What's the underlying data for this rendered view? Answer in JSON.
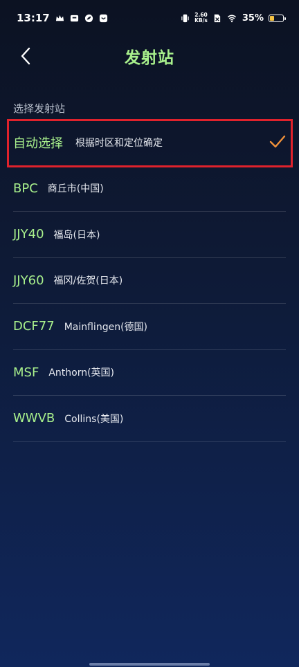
{
  "status_bar": {
    "time": "13:17",
    "speed_value": "2.60",
    "speed_unit": "KB/s",
    "battery_percent": "35%",
    "battery_level": 0.35
  },
  "header": {
    "title": "发射站"
  },
  "section_label": "选择发射站",
  "stations": [
    {
      "code": "自动选择",
      "desc": "根据时区和定位确定",
      "selected": true
    },
    {
      "code": "BPC",
      "desc": "商丘市(中国)",
      "selected": false
    },
    {
      "code": "JJY40",
      "desc": "福岛(日本)",
      "selected": false
    },
    {
      "code": "JJY60",
      "desc": "福冈/佐贺(日本)",
      "selected": false
    },
    {
      "code": "DCF77",
      "desc": "Mainflingen(德国)",
      "selected": false
    },
    {
      "code": "MSF",
      "desc": "Anthorn(英国)",
      "selected": false
    },
    {
      "code": "WWVB",
      "desc": "Collins(美国)",
      "selected": false
    }
  ],
  "colors": {
    "accent_green": "#a8f08c",
    "check_orange": "#f0913a",
    "highlight_red": "#e0222c"
  }
}
